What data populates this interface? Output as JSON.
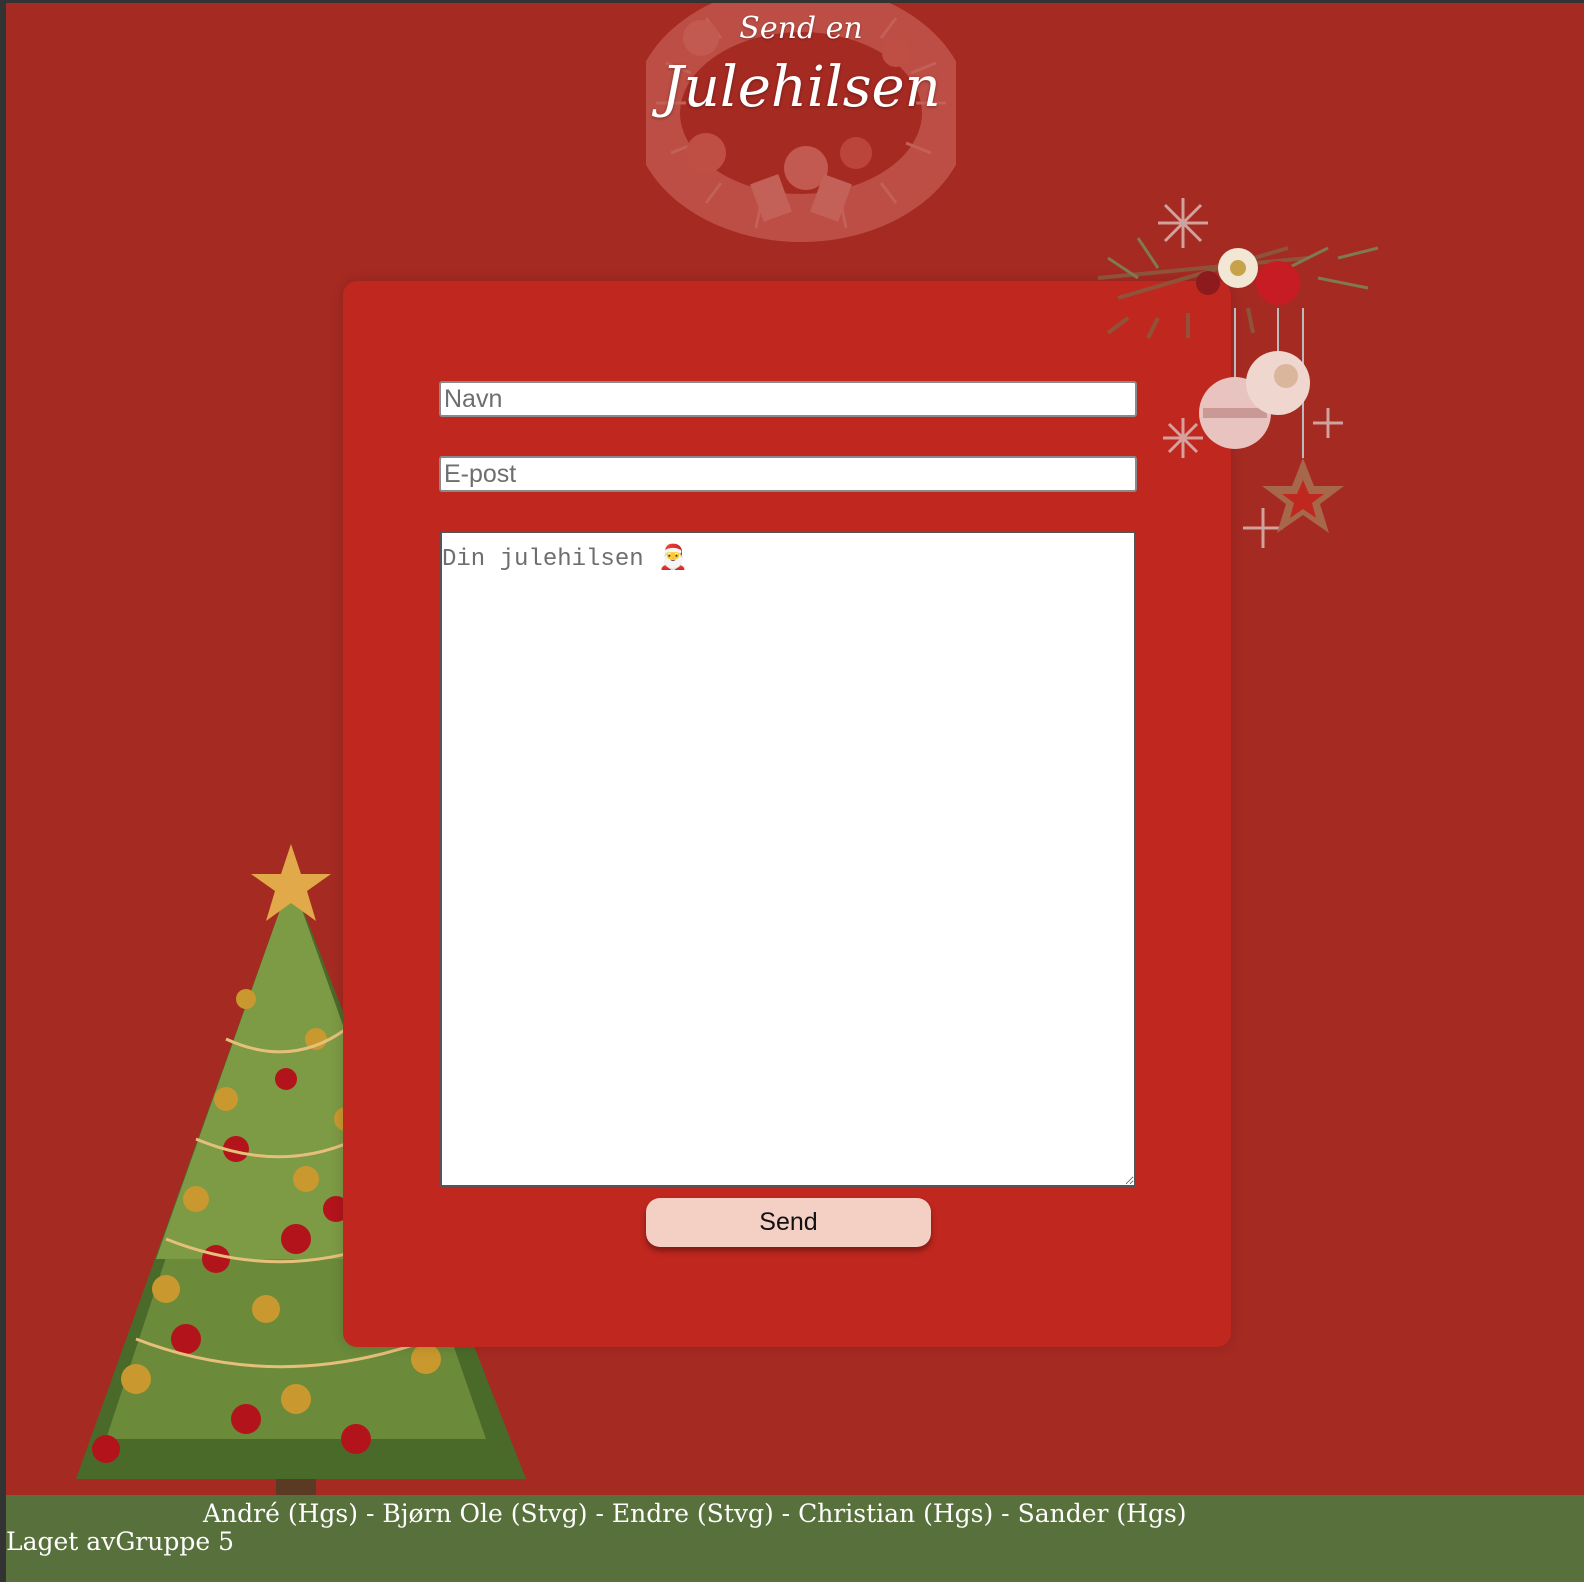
{
  "header": {
    "title_line1": "Send en",
    "title_line2": "Julehilsen"
  },
  "form": {
    "name_placeholder": "Navn",
    "email_placeholder": "E-post",
    "message_placeholder": "Din julehilsen 🎅",
    "send_label": "Send"
  },
  "footer": {
    "names": "André (Hgs) - Bjørn Ole (Stvg) - Endre (Stvg) - Christian (Hgs) - Sander (Hgs)",
    "credit": "Laget avGruppe 5"
  },
  "colors": {
    "background": "#a52a22",
    "card": "#c0271e",
    "button": "#f4cfc4",
    "footer": "#58703b"
  },
  "icons": {
    "header": "christmas-wreath-icon",
    "decoration": "christmas-ornaments-icon",
    "tree": "christmas-tree-icon"
  }
}
